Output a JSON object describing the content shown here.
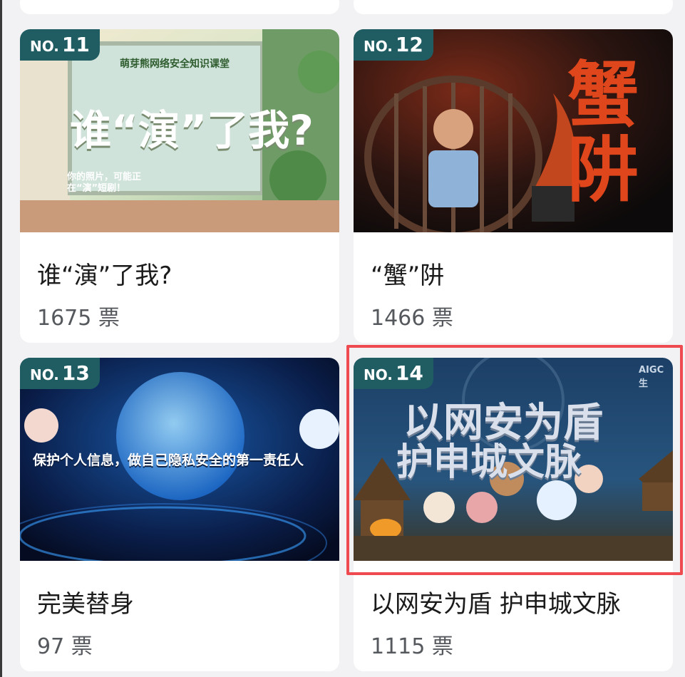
{
  "cards": [
    {
      "no_label": "NO.",
      "number": "11",
      "title": "谁“演”了我?",
      "votes": "1675 票",
      "image": {
        "caption_top": "萌芽熊网络安全知识课堂",
        "headline": "谁“演”了我?",
        "subtext": "你的照片，可能正在“演”短剧！"
      }
    },
    {
      "no_label": "NO.",
      "number": "12",
      "title": "“蟹”阱",
      "votes": "1466 票",
      "image": {
        "headline": "蟹阱"
      }
    },
    {
      "no_label": "NO.",
      "number": "13",
      "title": "完美替身",
      "votes": "97 票",
      "image": {
        "headline": "保护个人信息，做自己隐私安全的第一责任人"
      }
    },
    {
      "no_label": "NO.",
      "number": "14",
      "title": "以网安为盾 护申城文脉",
      "votes": "1115 票",
      "image": {
        "headline_line1": "以网安为盾",
        "headline_line2": "护申城文脉",
        "watermark": "AIGC生"
      }
    }
  ],
  "colors": {
    "badge_bg": "#1f5d63",
    "highlight": "#ef4a4f",
    "page_bg": "#f2f2f4"
  }
}
